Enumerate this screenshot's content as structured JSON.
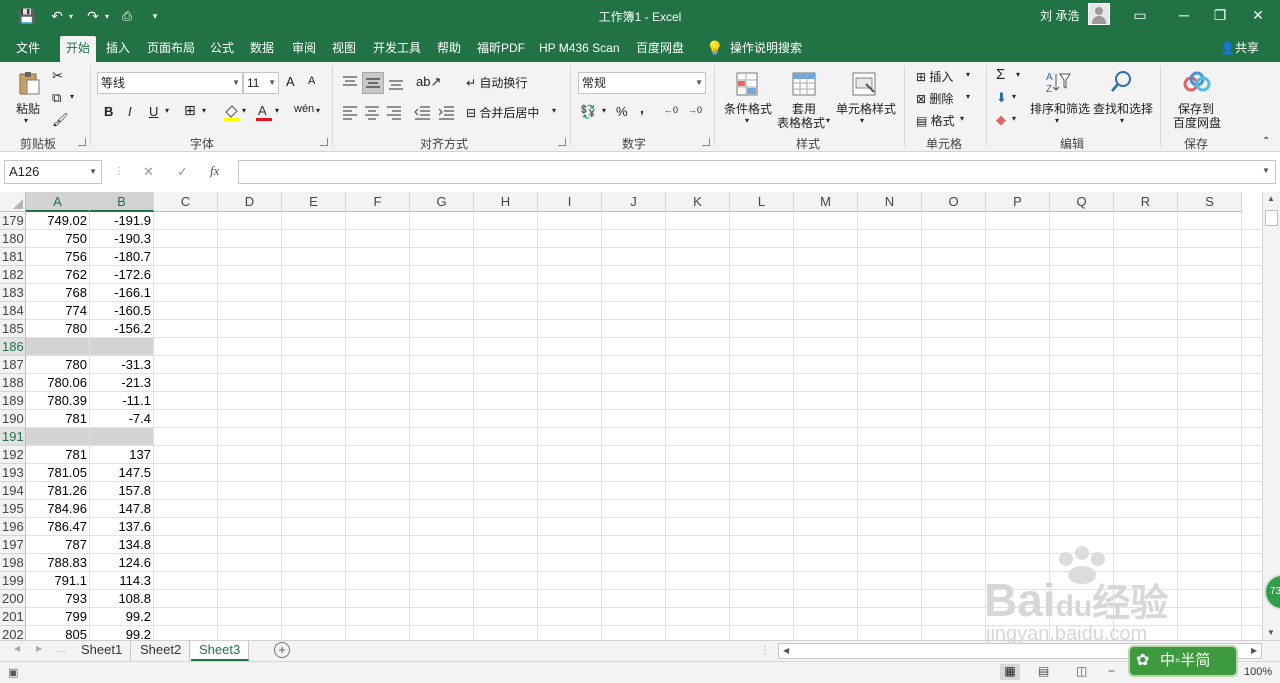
{
  "titlebar": {
    "title": "工作簿1  -  Excel",
    "user": "刘 承浩",
    "qa_save": "💾",
    "qa_undo": "↶",
    "qa_redo": "↷",
    "qa_more": "▾",
    "win_ribbon": "▭",
    "win_min": "─",
    "win_restore": "❐",
    "win_close": "✕"
  },
  "tabs": [
    "文件",
    "开始",
    "插入",
    "页面布局",
    "公式",
    "数据",
    "审阅",
    "视图",
    "开发工具",
    "帮助",
    "福昕PDF",
    "HP M436 Scan",
    "百度网盘"
  ],
  "tell_me": "操作说明搜索",
  "share": "共享",
  "ribbon": {
    "clipboard": {
      "paste": "粘贴",
      "label": "剪贴板"
    },
    "font": {
      "name": "等线",
      "size": "11",
      "grow": "A",
      "shrink": "A",
      "bold": "B",
      "italic": "I",
      "underline": "U",
      "label": "字体",
      "phonetic": "wén"
    },
    "alignment": {
      "wrap": "自动换行",
      "merge": "合并后居中",
      "label": "对齐方式"
    },
    "number": {
      "format": "常规",
      "percent": "%",
      "comma": ",",
      "label": "数字"
    },
    "styles": {
      "conditional": "条件格式",
      "table_fmt_1": "套用",
      "table_fmt_2": "表格格式",
      "cell_styles": "单元格样式",
      "label": "样式"
    },
    "cells": {
      "insert": "插入",
      "delete": "删除",
      "format": "格式",
      "label": "单元格"
    },
    "editing": {
      "sum": "Σ",
      "sort": "排序和筛选",
      "find": "查找和选择",
      "label": "编辑"
    },
    "save": {
      "line1": "保存到",
      "line2": "百度网盘",
      "label": "保存"
    }
  },
  "formula_bar": {
    "name_box": "A126",
    "cancel": "✕",
    "enter": "✓",
    "fx": "fx",
    "value": ""
  },
  "columns": [
    "A",
    "B",
    "C",
    "D",
    "E",
    "F",
    "G",
    "H",
    "I",
    "J",
    "K",
    "L",
    "M",
    "N",
    "O",
    "P",
    "Q",
    "R",
    "S"
  ],
  "rows": [
    {
      "n": "179",
      "a": "749.02",
      "b": "-191.9",
      "gray": false
    },
    {
      "n": "180",
      "a": "750",
      "b": "-190.3",
      "gray": false
    },
    {
      "n": "181",
      "a": "756",
      "b": "-180.7",
      "gray": false
    },
    {
      "n": "182",
      "a": "762",
      "b": "-172.6",
      "gray": false
    },
    {
      "n": "183",
      "a": "768",
      "b": "-166.1",
      "gray": false
    },
    {
      "n": "184",
      "a": "774",
      "b": "-160.5",
      "gray": false
    },
    {
      "n": "185",
      "a": "780",
      "b": "-156.2",
      "gray": false
    },
    {
      "n": "186",
      "a": "",
      "b": "",
      "gray": true
    },
    {
      "n": "187",
      "a": "780",
      "b": "-31.3",
      "gray": false
    },
    {
      "n": "188",
      "a": "780.06",
      "b": "-21.3",
      "gray": false
    },
    {
      "n": "189",
      "a": "780.39",
      "b": "-11.1",
      "gray": false
    },
    {
      "n": "190",
      "a": "781",
      "b": "-7.4",
      "gray": false
    },
    {
      "n": "191",
      "a": "",
      "b": "",
      "gray": true
    },
    {
      "n": "192",
      "a": "781",
      "b": "137",
      "gray": false
    },
    {
      "n": "193",
      "a": "781.05",
      "b": "147.5",
      "gray": false
    },
    {
      "n": "194",
      "a": "781.26",
      "b": "157.8",
      "gray": false
    },
    {
      "n": "195",
      "a": "784.96",
      "b": "147.8",
      "gray": false
    },
    {
      "n": "196",
      "a": "786.47",
      "b": "137.6",
      "gray": false
    },
    {
      "n": "197",
      "a": "787",
      "b": "134.8",
      "gray": false
    },
    {
      "n": "198",
      "a": "788.83",
      "b": "124.6",
      "gray": false
    },
    {
      "n": "199",
      "a": "791.1",
      "b": "114.3",
      "gray": false
    },
    {
      "n": "200",
      "a": "793",
      "b": "108.8",
      "gray": false
    },
    {
      "n": "201",
      "a": "799",
      "b": "99.2",
      "gray": false
    },
    {
      "n": "202",
      "a": "805",
      "b": "99.2",
      "gray": false
    }
  ],
  "sheets": [
    {
      "name": "Sheet1",
      "active": false
    },
    {
      "name": "Sheet2",
      "active": false
    },
    {
      "name": "Sheet3",
      "active": true
    }
  ],
  "add_sheet": "+",
  "status": {
    "zoom": "100%",
    "minus": "−"
  },
  "watermark": {
    "brand": "Bai",
    "brand2": "du",
    "brand3": "经验",
    "url": "jingyan.baidu.com",
    "badge": "73",
    "logo_text": "中◦半简"
  },
  "colors": {
    "accent": "#217346",
    "ribbon_bg": "#f3f3f3",
    "selected_row": "#d4d4d4"
  }
}
